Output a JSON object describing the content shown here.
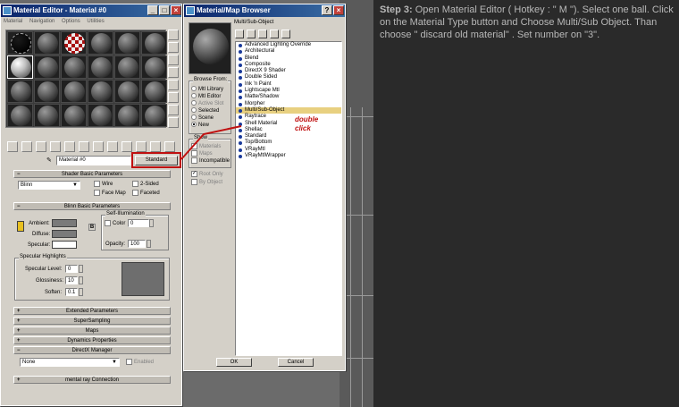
{
  "material_editor": {
    "title": "Material Editor - Material #0",
    "menu": [
      "Material",
      "Navigation",
      "Options",
      "Utilities"
    ],
    "material_name": "Material #0",
    "type_button": "Standard",
    "shader_params": {
      "header": "Shader Basic Parameters",
      "shader": "Blinn",
      "wire": "Wire",
      "two_sided": "2-Sided",
      "face_map": "Face Map",
      "faceted": "Faceted"
    },
    "blinn_params": {
      "header": "Blinn Basic Parameters",
      "self_illum": "Self-Illumination",
      "color_label": "Color",
      "color_value": "0",
      "ambient": "Ambient:",
      "diffuse": "Diffuse:",
      "specular": "Specular:",
      "opacity_label": "Opacity:",
      "opacity_value": "100"
    },
    "highlights": {
      "header": "Specular Highlights",
      "level_label": "Specular Level:",
      "level_value": "0",
      "gloss_label": "Glossiness:",
      "gloss_value": "10",
      "soften_label": "Soften:",
      "soften_value": "0.1"
    },
    "rollouts": [
      "Extended Parameters",
      "SuperSampling",
      "Maps",
      "Dynamics Properties",
      "DirectX Manager"
    ],
    "dx_value": "None",
    "dx_enabled": "Enabled",
    "mental_ray": "mental ray Connection"
  },
  "browser": {
    "title": "Material/Map Browser",
    "selected_label": "Multi/Sub-Object",
    "browse_from": {
      "header": "Browse From:",
      "options": [
        "Mtl Library",
        "Mtl Editor",
        "Active Slot",
        "Selected",
        "Scene",
        "New"
      ]
    },
    "show": {
      "header": "Show",
      "options": [
        "Materials",
        "Maps",
        "Incompatible"
      ]
    },
    "filters": [
      "Root Only",
      "By Object"
    ],
    "items": [
      "Advanced Lighting Override",
      "Architectural",
      "Blend",
      "Composite",
      "DirectX 9 Shader",
      "Double Sided",
      "Ink 'n Paint",
      "Lightscape Mtl",
      "Matte/Shadow",
      "Morpher",
      "Multi/Sub-Object",
      "Raytrace",
      "Shell Material",
      "Shellac",
      "Standard",
      "Top/Bottom",
      "VRayMtl",
      "VRayMtlWrapper"
    ],
    "ok": "OK",
    "cancel": "Cancel"
  },
  "annotation": {
    "text_line1": "double",
    "text_line2": "click"
  },
  "instructions": {
    "step": "Step 3:",
    "text": " Open Material Editor ( Hotkey : \" M \"). Select one ball. Click on the Material Type button and Choose Multi/Sub Object. Than choose \" discard old material\" . Set number on \"3\"."
  },
  "colors": {
    "annotation": "#c01010",
    "title_bar": "#0a246a",
    "instruction_text": "#b8b8b8",
    "selected_item": "#e8d080"
  }
}
